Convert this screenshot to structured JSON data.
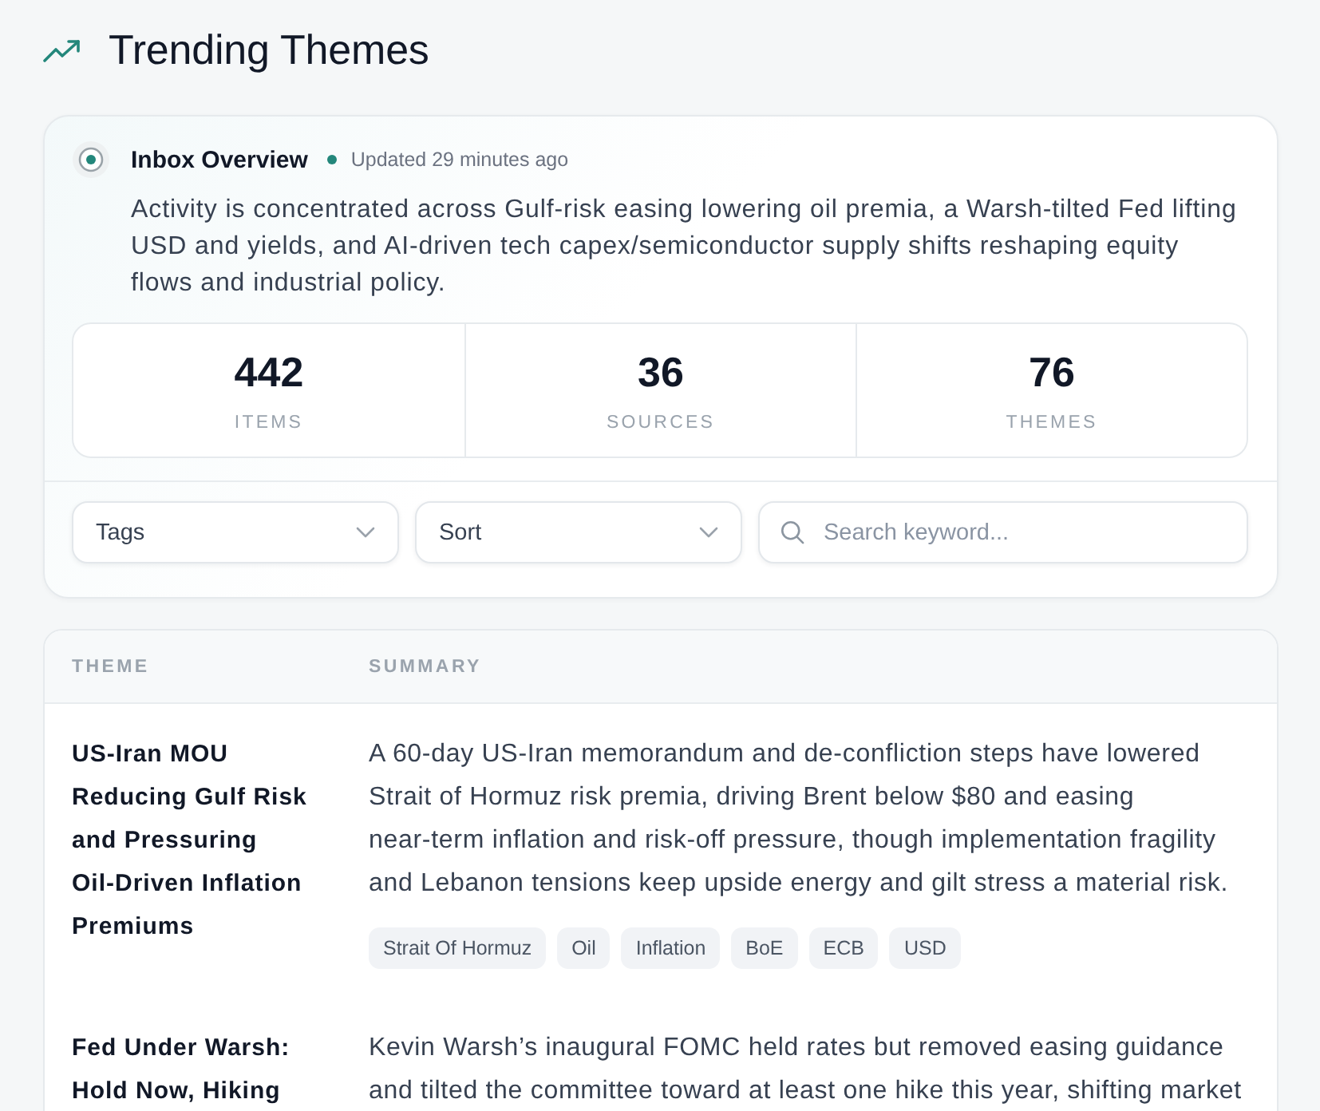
{
  "header": {
    "title": "Trending Themes"
  },
  "overview": {
    "title": "Inbox Overview",
    "updated": "Updated 29 minutes ago",
    "summary": "Activity is concentrated across Gulf-risk easing lowering oil premia, a Warsh-tilted Fed lifting USD and yields, and AI-driven tech capex/semiconductor supply shifts reshaping equity flows and industrial policy.",
    "stats": [
      {
        "value": "442",
        "label": "ITEMS"
      },
      {
        "value": "36",
        "label": "SOURCES"
      },
      {
        "value": "76",
        "label": "THEMES"
      }
    ]
  },
  "filters": [
    {
      "kind": "dropdown",
      "label": "Tags"
    },
    {
      "kind": "dropdown",
      "label": "Sort"
    },
    {
      "kind": "search",
      "placeholder": "Search keyword..."
    }
  ],
  "table": {
    "columns": [
      "THEME",
      "SUMMARY"
    ],
    "rows": [
      {
        "theme": "US-Iran MOU Reducing Gulf Risk and Pressuring Oil-Driven Inflation Premiums",
        "summary": "A 60-day US-Iran memorandum and de-confliction steps have lowered Strait of Hormuz risk premia, driving Brent below $80 and easing near-term inflation and risk-off pressure, though implementation fragility and Lebanon tensions keep upside energy and gilt stress a material risk.",
        "tags": [
          "Strait Of Hormuz",
          "Oil",
          "Inflation",
          "BoE",
          "ECB",
          "USD"
        ]
      },
      {
        "theme": "Fed Under Warsh: Hold Now, Hiking",
        "summary": "Kevin Warsh’s inaugural FOMC held rates but removed easing guidance and tilted the committee toward at least one hike this year, shifting market"
      }
    ]
  }
}
